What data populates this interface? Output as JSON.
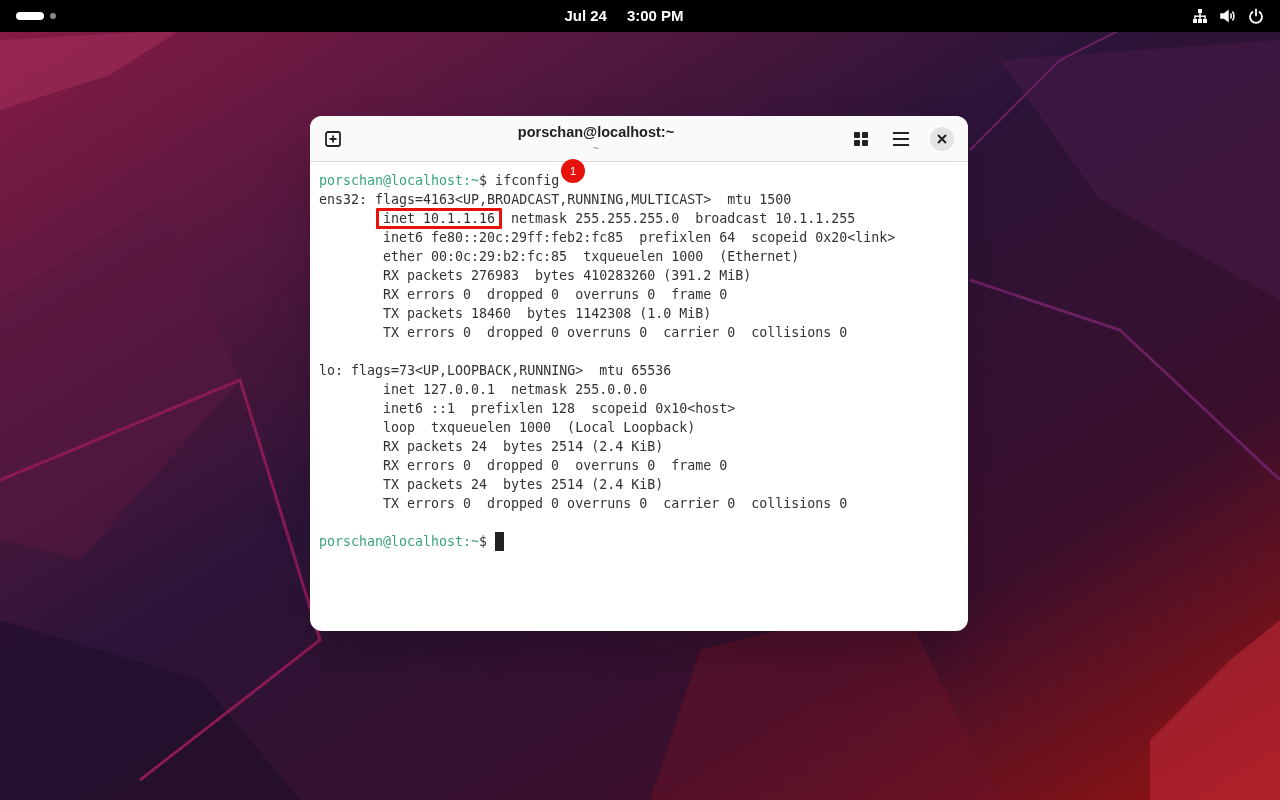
{
  "top_bar": {
    "date": "Jul 24",
    "time": "3:00 PM"
  },
  "terminal": {
    "title": "porschan@localhost:~",
    "subtitle": "~",
    "lines": [
      {
        "kind": "prompt",
        "prompt": "porschan@localhost:~",
        "command": "$ ifconfig",
        "badge": "1"
      },
      {
        "kind": "output",
        "indented": false,
        "text": "ens32: flags=4163<UP,BROADCAST,RUNNING,MULTICAST>  mtu 1500"
      },
      {
        "kind": "output",
        "indented": true,
        "highlight": "inet 10.1.1.16",
        "text": "  netmask 255.255.255.0  broadcast 10.1.1.255"
      },
      {
        "kind": "output",
        "indented": true,
        "text": "inet6 fe80::20c:29ff:feb2:fc85  prefixlen 64  scopeid 0x20<link>"
      },
      {
        "kind": "output",
        "indented": true,
        "text": "ether 00:0c:29:b2:fc:85  txqueuelen 1000  (Ethernet)"
      },
      {
        "kind": "output",
        "indented": true,
        "text": "RX packets 276983  bytes 410283260 (391.2 MiB)"
      },
      {
        "kind": "output",
        "indented": true,
        "text": "RX errors 0  dropped 0  overruns 0  frame 0"
      },
      {
        "kind": "output",
        "indented": true,
        "text": "TX packets 18460  bytes 1142308 (1.0 MiB)"
      },
      {
        "kind": "output",
        "indented": true,
        "text": "TX errors 0  dropped 0 overruns 0  carrier 0  collisions 0"
      },
      {
        "kind": "blank"
      },
      {
        "kind": "output",
        "indented": false,
        "text": "lo: flags=73<UP,LOOPBACK,RUNNING>  mtu 65536"
      },
      {
        "kind": "output",
        "indented": true,
        "text": "inet 127.0.0.1  netmask 255.0.0.0"
      },
      {
        "kind": "output",
        "indented": true,
        "text": "inet6 ::1  prefixlen 128  scopeid 0x10<host>"
      },
      {
        "kind": "output",
        "indented": true,
        "text": "loop  txqueuelen 1000  (Local Loopback)"
      },
      {
        "kind": "output",
        "indented": true,
        "text": "RX packets 24  bytes 2514 (2.4 KiB)"
      },
      {
        "kind": "output",
        "indented": true,
        "text": "RX errors 0  dropped 0  overruns 0  frame 0"
      },
      {
        "kind": "output",
        "indented": true,
        "text": "TX packets 24  bytes 2514 (2.4 KiB)"
      },
      {
        "kind": "output",
        "indented": true,
        "text": "TX errors 0  dropped 0 overruns 0  carrier 0  collisions 0"
      },
      {
        "kind": "blank"
      },
      {
        "kind": "prompt",
        "prompt": "porschan@localhost:~",
        "command": "$",
        "cursor": true
      }
    ]
  }
}
